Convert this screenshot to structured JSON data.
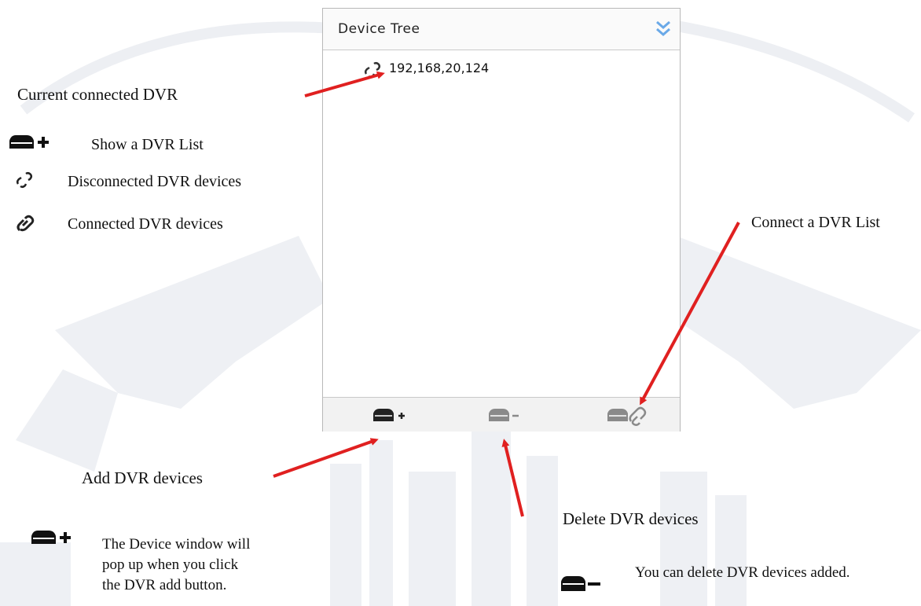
{
  "panel": {
    "title": "Device Tree",
    "nodes": [
      {
        "label": "192,168,20,124"
      }
    ],
    "toolbar": [
      "add-dvr",
      "delete-dvr",
      "connect-dvr-list"
    ]
  },
  "annotations": {
    "current_connected": "Current connected DVR",
    "show_list": "Show a DVR List",
    "disconnected": "Disconnected DVR devices",
    "connected": "Connected DVR devices",
    "connect_list": "Connect a DVR List",
    "add_devices": "Add DVR devices",
    "delete_devices": "Delete DVR devices",
    "add_popup_note": "The Device window will pop up when you click the DVR add button.",
    "delete_note": "You can delete DVR devices added."
  },
  "colors": {
    "arrow": "#e02020",
    "toolbar_bg": "#f2f2f2",
    "collapse_icon": "#6aa9e8",
    "icon_dark": "#222222",
    "icon_disabled": "#8a8a8a"
  },
  "icons": [
    "chevron-double-down-icon",
    "link-broken-icon",
    "link-icon",
    "dvr-add-icon",
    "dvr-remove-icon",
    "dvr-connect-icon"
  ]
}
